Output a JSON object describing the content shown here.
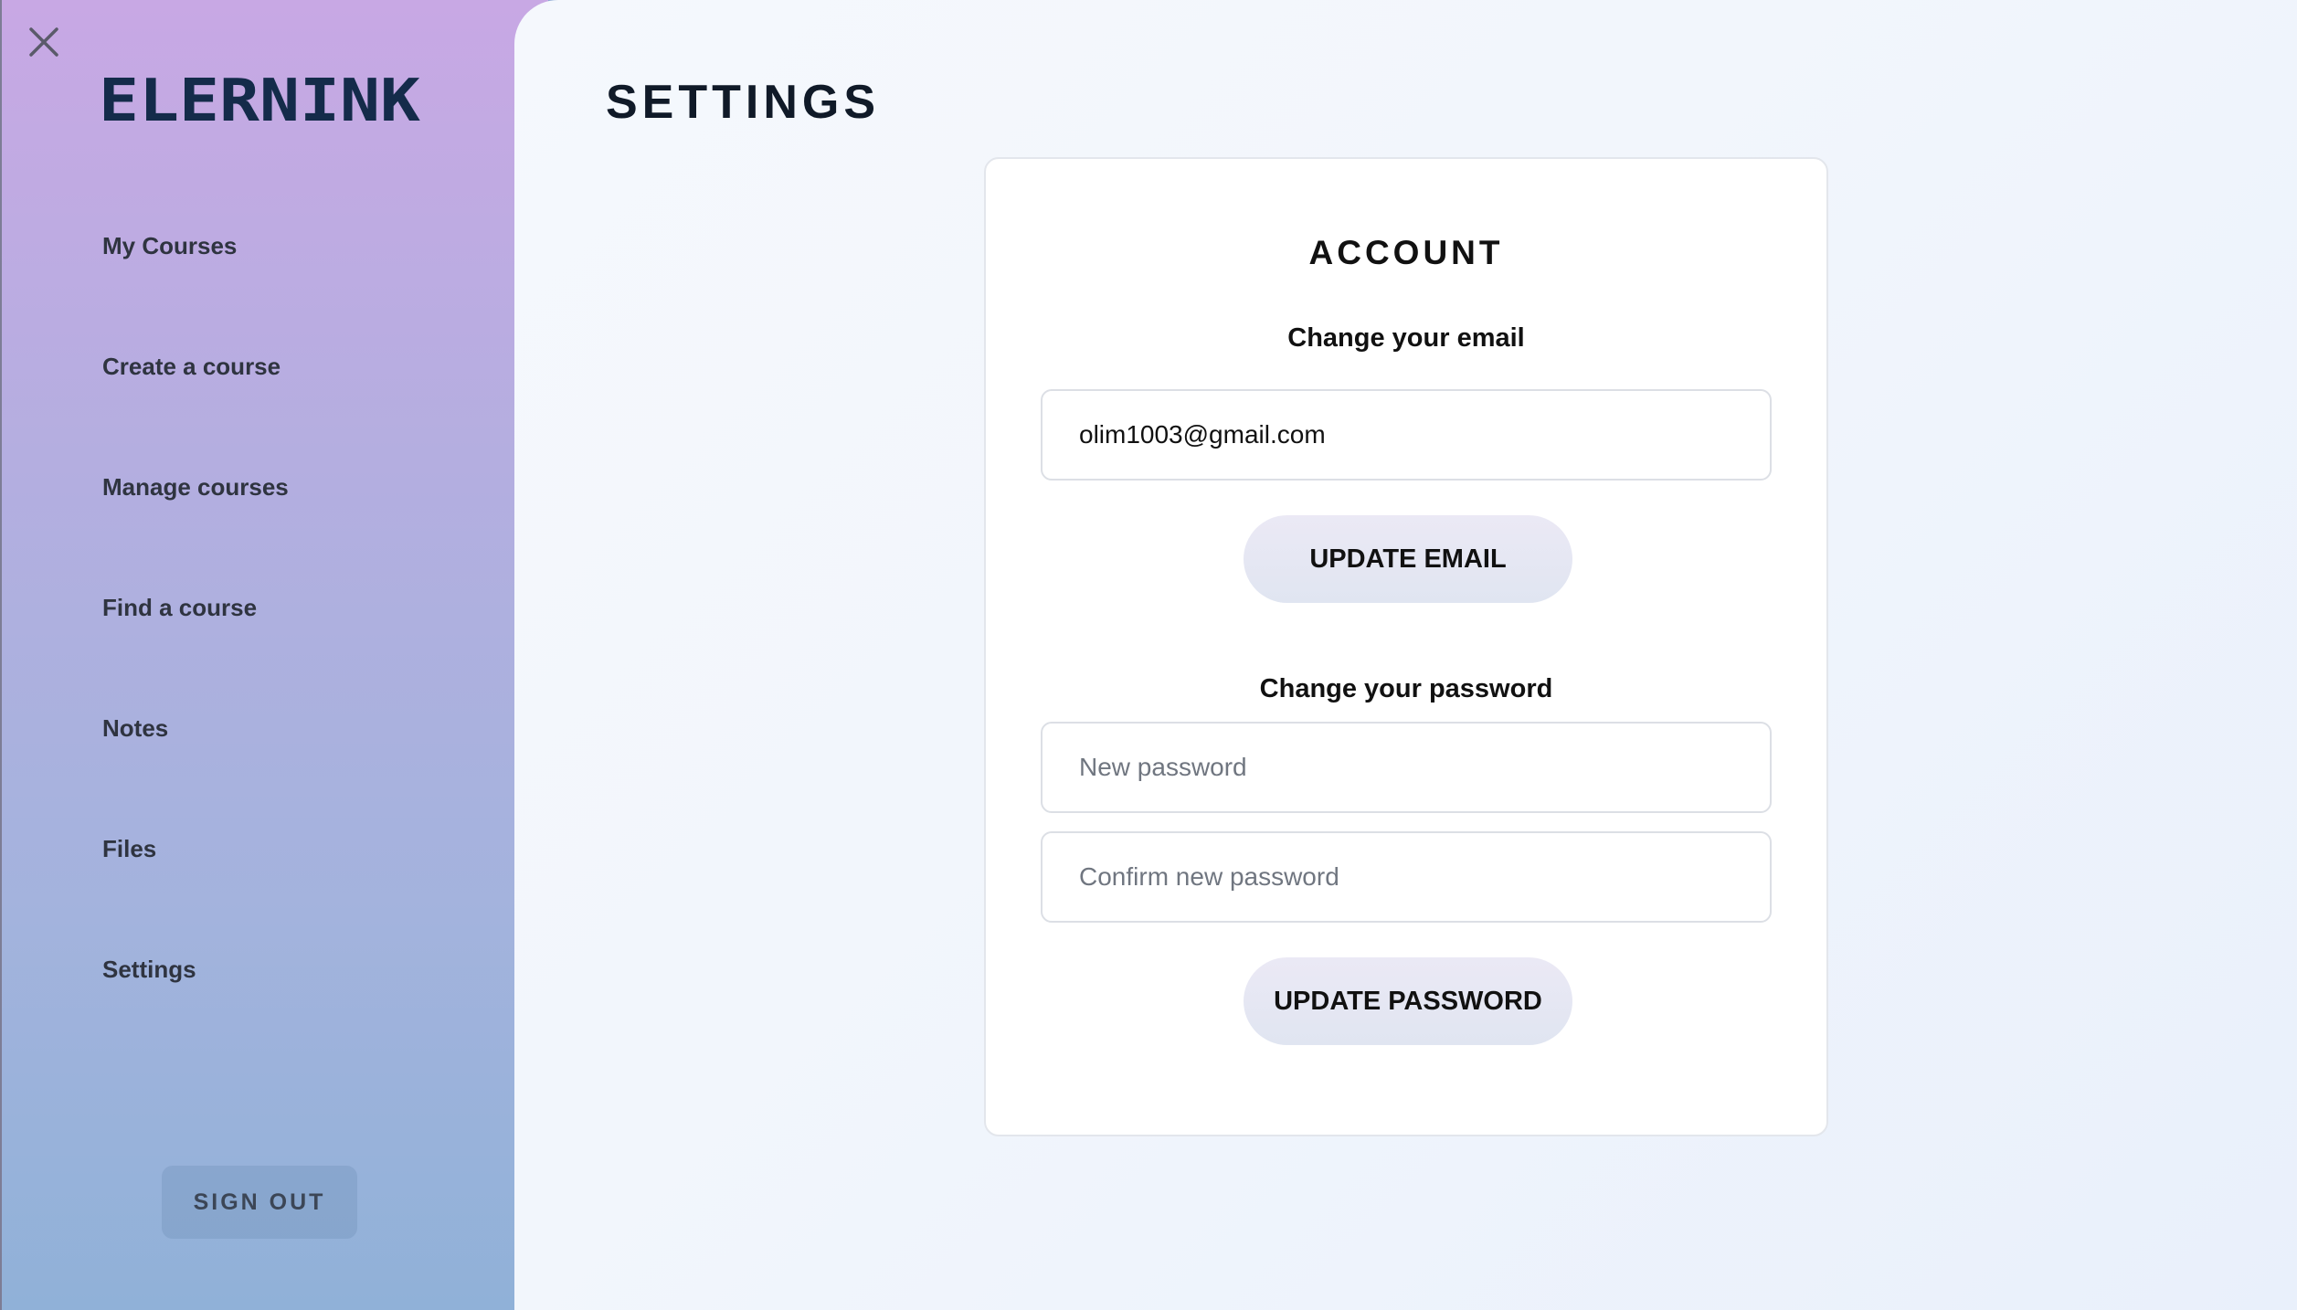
{
  "app": {
    "logo_text": "ELERNINK",
    "logo_color": "#142b4a"
  },
  "sidebar": {
    "items": [
      {
        "label": "My Courses"
      },
      {
        "label": "Create a course"
      },
      {
        "label": "Manage courses"
      },
      {
        "label": "Find a course"
      },
      {
        "label": "Notes"
      },
      {
        "label": "Files"
      },
      {
        "label": "Settings"
      }
    ],
    "sign_out_label": "SIGN OUT",
    "close_icon": "close-icon"
  },
  "main": {
    "title": "SETTINGS",
    "account": {
      "title": "ACCOUNT",
      "email_section_label": "Change your email",
      "email_value": "olim1003@gmail.com",
      "update_email_label": "UPDATE EMAIL",
      "password_section_label": "Change your password",
      "new_password_placeholder": "New password",
      "confirm_password_placeholder": "Confirm new password",
      "update_password_label": "UPDATE PASSWORD"
    }
  },
  "colors": {
    "sidebar_gradient_top": "#c8a8e4",
    "sidebar_gradient_bottom": "#90b1d8",
    "main_background": "#f3f7fd",
    "button_background": "#e6e7f3"
  }
}
